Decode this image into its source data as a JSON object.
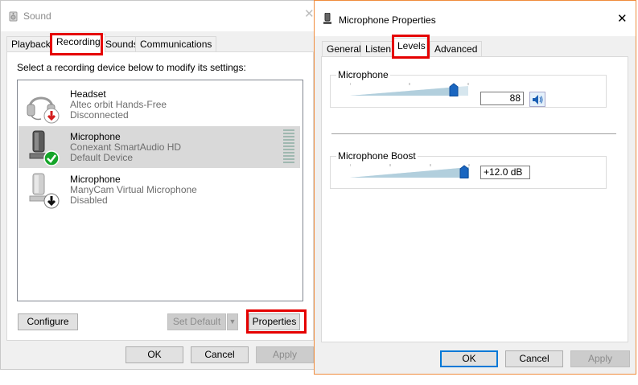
{
  "sound_window": {
    "title": "Sound",
    "tabs": [
      "Playback",
      "Recording",
      "Sounds",
      "Communications"
    ],
    "selected_tab": "Recording",
    "instruction": "Select a recording device below to modify its settings:",
    "devices": [
      {
        "name": "Headset",
        "description": "Altec orbit Hands-Free",
        "status": "Disconnected",
        "icon": "headset-icon",
        "badge": "red-down-arrow-badge"
      },
      {
        "name": "Microphone",
        "description": "Conexant SmartAudio HD",
        "status": "Default Device",
        "icon": "microphone-icon",
        "badge": "green-check-badge",
        "selected": true
      },
      {
        "name": "Microphone",
        "description": "ManyCam Virtual Microphone",
        "status": "Disabled",
        "icon": "microphone-icon",
        "badge": "black-down-arrow-badge"
      }
    ],
    "buttons": {
      "configure": "Configure",
      "set_default": "Set Default",
      "properties": "Properties",
      "ok": "OK",
      "cancel": "Cancel",
      "apply": "Apply"
    }
  },
  "mic_window": {
    "title": "Microphone Properties",
    "tabs": [
      "General",
      "Listen",
      "Levels",
      "Advanced"
    ],
    "selected_tab": "Levels",
    "microphone": {
      "label": "Microphone",
      "value": "88",
      "level": 0.88
    },
    "boost": {
      "label": "Microphone Boost",
      "value": "+12.0 dB",
      "level": 1.0
    },
    "buttons": {
      "ok": "OK",
      "cancel": "Cancel",
      "apply": "Apply"
    }
  },
  "colors": {
    "highlight": "#e50000",
    "accent": "#0078d7",
    "active_border": "#f08c3c",
    "check_green": "#16a52a",
    "down_red": "#d42020"
  }
}
